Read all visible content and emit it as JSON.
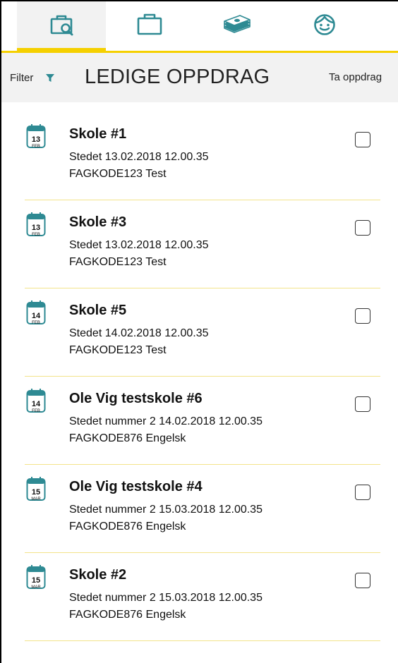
{
  "tabs": [
    {
      "name": "available-jobs",
      "icon": "briefcase-search-icon",
      "active": true
    },
    {
      "name": "my-jobs",
      "icon": "briefcase-icon",
      "active": false
    },
    {
      "name": "payments",
      "icon": "money-stack-icon",
      "active": false
    },
    {
      "name": "profile",
      "icon": "face-icon",
      "active": false
    }
  ],
  "header": {
    "filter_label": "Filter",
    "title": "LEDIGE OPPDRAG",
    "take_label": "Ta oppdrag"
  },
  "colors": {
    "accent": "#f5d000",
    "icon_teal": "#2e8a93",
    "header_bg": "#f2f2f2"
  },
  "items": [
    {
      "day": "13",
      "month": "FEB",
      "title": "Skole #1",
      "line1": "Stedet 13.02.2018 12.00.35",
      "line2": "FAGKODE123 Test",
      "checked": false
    },
    {
      "day": "13",
      "month": "FEB",
      "title": "Skole #3",
      "line1": "Stedet 13.02.2018 12.00.35",
      "line2": "FAGKODE123 Test",
      "checked": false
    },
    {
      "day": "14",
      "month": "FEB",
      "title": "Skole #5",
      "line1": "Stedet 14.02.2018 12.00.35",
      "line2": "FAGKODE123 Test",
      "checked": false
    },
    {
      "day": "14",
      "month": "FEB",
      "title": "Ole Vig testskole #6",
      "line1": "Stedet nummer 2 14.02.2018 12.00.35",
      "line2": "FAGKODE876 Engelsk",
      "checked": false
    },
    {
      "day": "15",
      "month": "MAR",
      "title": "Ole Vig testskole #4",
      "line1": "Stedet nummer 2 15.03.2018 12.00.35",
      "line2": "FAGKODE876 Engelsk",
      "checked": false
    },
    {
      "day": "15",
      "month": "MAR",
      "title": "Skole #2",
      "line1": "Stedet nummer 2 15.03.2018 12.00.35",
      "line2": "FAGKODE876 Engelsk",
      "checked": false
    }
  ]
}
